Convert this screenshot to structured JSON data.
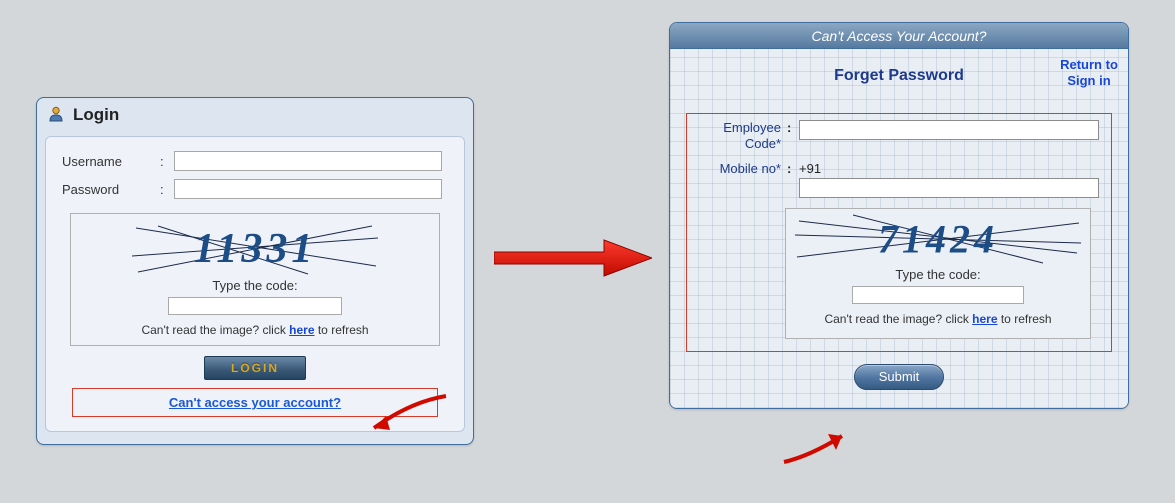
{
  "login": {
    "title": "Login",
    "username_label": "Username",
    "password_label": "Password",
    "captcha_value": "11331",
    "type_code_label": "Type the code:",
    "refresh_prefix": "Can't read the image? click ",
    "refresh_link": "here",
    "refresh_suffix": " to refresh",
    "login_button": "LOGIN",
    "forgot_link": "Can't access your account?"
  },
  "forgot": {
    "header": "Can't Access Your Account?",
    "title": "Forget Password",
    "return_link": "Return to Sign in",
    "employee_label": "Employee Code*",
    "mobile_label": "Mobile no*",
    "mobile_prefix": "+91",
    "captcha_value": "71424",
    "type_code_label": "Type the code:",
    "refresh_prefix": "Can't read the image? click ",
    "refresh_link": "here",
    "refresh_suffix": " to refresh",
    "submit_button": "Submit"
  }
}
